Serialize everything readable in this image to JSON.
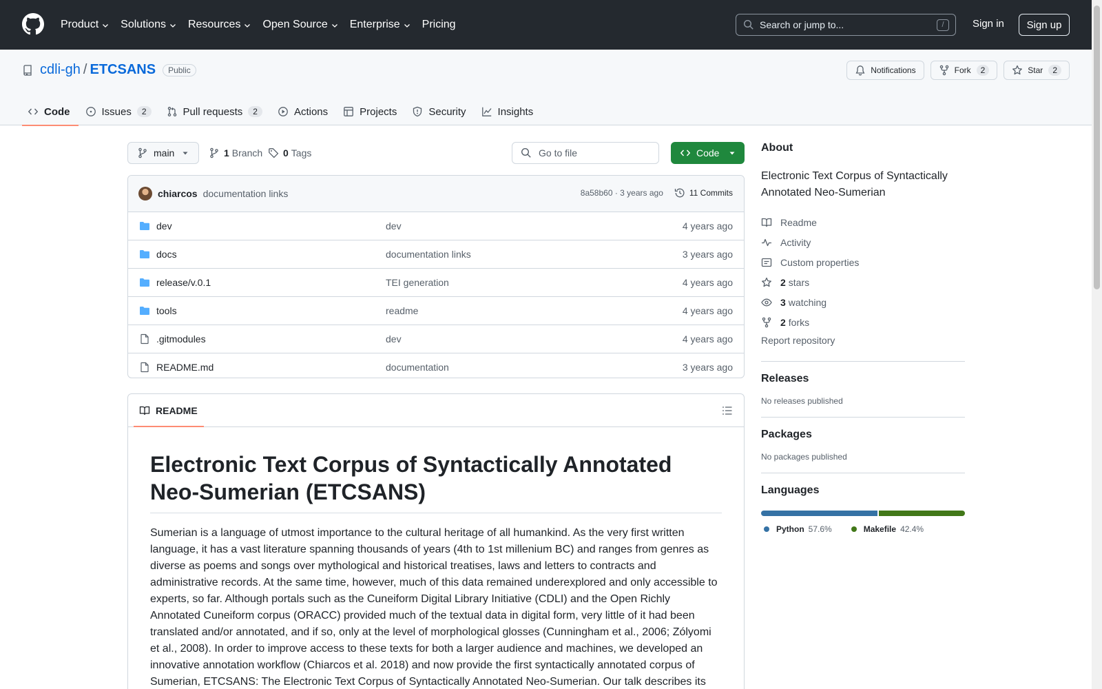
{
  "topnav": {
    "items": [
      {
        "label": "Product",
        "dropdown": true
      },
      {
        "label": "Solutions",
        "dropdown": true
      },
      {
        "label": "Resources",
        "dropdown": true
      },
      {
        "label": "Open Source",
        "dropdown": true
      },
      {
        "label": "Enterprise",
        "dropdown": true
      },
      {
        "label": "Pricing",
        "dropdown": false
      }
    ],
    "search_placeholder": "Search or jump to...",
    "search_key": "/",
    "signin": "Sign in",
    "signup": "Sign up"
  },
  "repo": {
    "owner": "cdli-gh",
    "separator": "/",
    "name": "ETCSANS",
    "visibility": "Public",
    "notifications_label": "Notifications",
    "fork_label": "Fork",
    "fork_count": "2",
    "star_label": "Star",
    "star_count": "2"
  },
  "tabs": [
    {
      "label": "Code",
      "icon": "code-icon",
      "count": ""
    },
    {
      "label": "Issues",
      "icon": "issue-icon",
      "count": "2"
    },
    {
      "label": "Pull requests",
      "icon": "pull-request-icon",
      "count": "2"
    },
    {
      "label": "Actions",
      "icon": "play-icon",
      "count": ""
    },
    {
      "label": "Projects",
      "icon": "table-icon",
      "count": ""
    },
    {
      "label": "Security",
      "icon": "shield-icon",
      "count": ""
    },
    {
      "label": "Insights",
      "icon": "graph-icon",
      "count": ""
    }
  ],
  "toolbar": {
    "branch": "main",
    "branch_count": "1",
    "branch_label": "Branch",
    "tag_count": "0",
    "tag_label": "Tags",
    "goto_placeholder": "Go to file",
    "code_label": "Code"
  },
  "commit": {
    "author": "chiarcos",
    "message": "documentation links",
    "hash_time": "8a58b60 · 3 years ago",
    "commits_label": "11 Commits"
  },
  "files": [
    {
      "type": "dir",
      "name": "dev",
      "message": "dev",
      "date": "4 years ago"
    },
    {
      "type": "dir",
      "name": "docs",
      "message": "documentation links",
      "date": "3 years ago"
    },
    {
      "type": "dir",
      "name": "release/v.0.1",
      "message": "TEI generation",
      "date": "4 years ago"
    },
    {
      "type": "dir",
      "name": "tools",
      "message": "readme",
      "date": "4 years ago"
    },
    {
      "type": "file",
      "name": ".gitmodules",
      "message": "dev",
      "date": "4 years ago"
    },
    {
      "type": "file",
      "name": "README.md",
      "message": "documentation",
      "date": "3 years ago"
    }
  ],
  "readme": {
    "tab_label": "README",
    "title": "Electronic Text Corpus of Syntactically Annotated Neo-Sumerian (ETCSANS)",
    "paragraph": "Sumerian is a language of utmost importance to the cultural heritage of all humankind. As the very first written language, it has a vast literature spanning thousands of years (4th to 1st millenium BC) and ranges from genres as diverse as poems and songs over mythological and historical treatises, laws and letters to contracts and administrative records. At the same time, however, much of this data remained underexplored and only accessible to experts, so far. Although portals such as the Cuneiform Digital Library Initiative (CDLI) and the Open Richly Annotated Cuneiform corpus (ORACC) provided much of the textual data in digital form, very little of it had been translated and/or annotated, and if so, only at the level of morphological glosses (Cunningham et al., 2006; Zólyomi et al., 2008). In order to improve access to these texts for both a larger audience and machines, we developed an innovative annotation workflow (Chiarcos et al. 2018) and now provide the first syntactically annotated corpus of Sumerian, ETCSANS: The Electronic Text Corpus of Syntactically Annotated Neo-Sumerian. Our talk describes its"
  },
  "about": {
    "heading": "About",
    "description": "Electronic Text Corpus of Syntactically Annotated Neo-Sumerian",
    "readme": "Readme",
    "activity": "Activity",
    "custom_properties": "Custom properties",
    "stars_count": "2",
    "stars_label": "stars",
    "watching_count": "3",
    "watching_label": "watching",
    "forks_count": "2",
    "forks_label": "forks",
    "report": "Report repository"
  },
  "releases": {
    "heading": "Releases",
    "empty": "No releases published"
  },
  "packages": {
    "heading": "Packages",
    "empty": "No packages published"
  },
  "languages": {
    "heading": "Languages",
    "items": [
      {
        "name": "Python",
        "percent": "57.6%",
        "value": 57.6,
        "color": "#3572A5"
      },
      {
        "name": "Makefile",
        "percent": "42.4%",
        "value": 42.4,
        "color": "#427819"
      }
    ]
  },
  "colors": {
    "accent": "#0969da",
    "primary_button": "#1f883d",
    "tab_underline": "#fd8c73",
    "topbar": "#24292f"
  }
}
